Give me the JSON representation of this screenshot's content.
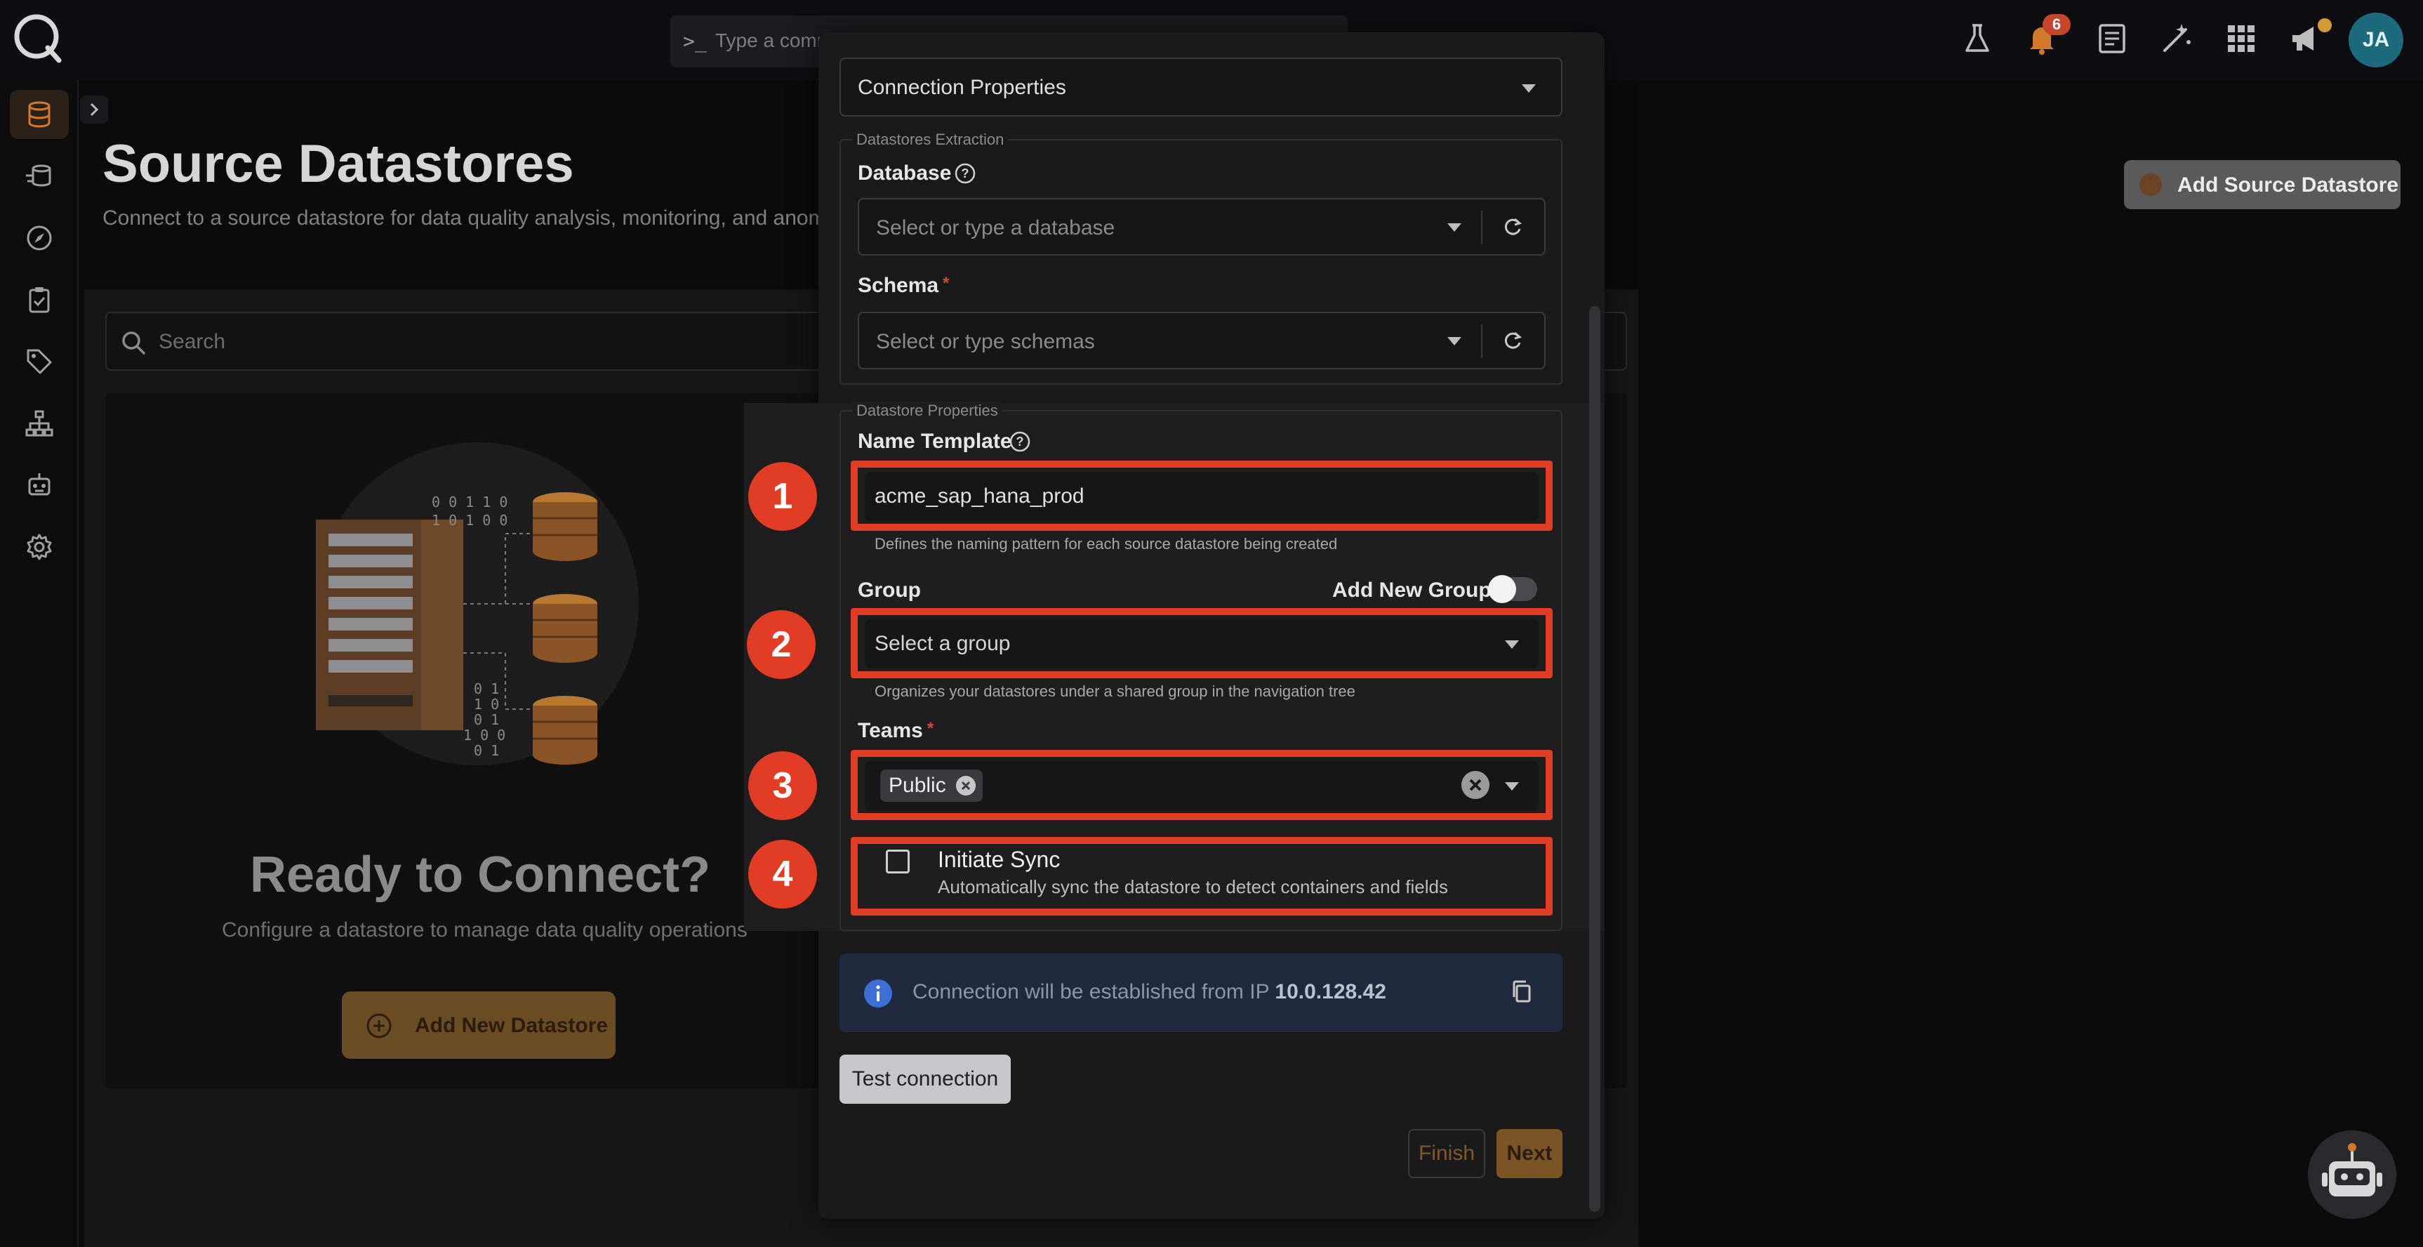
{
  "topbar": {
    "command_placeholder": "Type a comm",
    "command_prompt": ">_",
    "notification_count": "6",
    "avatar_initials": "JA"
  },
  "sidebar": {
    "items": [
      {
        "icon": "database-icon",
        "active": true
      },
      {
        "icon": "datastore-stack-icon"
      },
      {
        "icon": "compass-icon"
      },
      {
        "icon": "clipboard-check-icon"
      },
      {
        "icon": "tag-icon"
      },
      {
        "icon": "hierarchy-icon"
      },
      {
        "icon": "robot-icon"
      },
      {
        "icon": "gear-icon"
      }
    ]
  },
  "page": {
    "title": "Source Datastores",
    "subtitle": "Connect to a source datastore for data quality analysis, monitoring, and anomal",
    "add_source_label": "Add Source Datastore",
    "search_placeholder": "Search",
    "empty_title": "Ready to Connect?",
    "empty_subtitle": "Configure a datastore to manage data quality operations",
    "add_new_label": "Add New Datastore"
  },
  "illustration": {
    "binary_rows": [
      "0 0 1 1 0",
      "1 0 1 0 0"
    ],
    "binary_col": [
      "0 1",
      "1 0",
      "0 1",
      "1 0 0",
      "0 1"
    ]
  },
  "modal": {
    "connection_properties": "Connection Properties",
    "extraction": {
      "legend": "Datastores Extraction",
      "database_label": "Database",
      "database_placeholder": "Select or type a database",
      "schema_label": "Schema",
      "schema_placeholder": "Select or type schemas",
      "required_mark": "*"
    },
    "properties": {
      "legend": "Datastore Properties",
      "name_template_label": "Name Template",
      "name_template_value": "acme_sap_hana_prod",
      "name_template_hint": "Defines the naming pattern for each source datastore being created",
      "group_label": "Group",
      "add_new_group_label": "Add New Group",
      "add_new_group_enabled": false,
      "group_placeholder": "Select a group",
      "group_hint": "Organizes your datastores under a shared group in the navigation tree",
      "teams_label": "Teams",
      "teams_selected": [
        "Public"
      ],
      "initiate_sync_label": "Initiate Sync",
      "initiate_sync_desc": "Automatically sync the datastore to detect containers and fields",
      "initiate_sync_checked": false
    },
    "markers": [
      "1",
      "2",
      "3",
      "4"
    ],
    "info": {
      "text": "Connection will be established from IP",
      "ip": "10.0.128.42"
    },
    "test_connection_label": "Test connection",
    "finish_label": "Finish",
    "next_label": "Next"
  },
  "colors": {
    "accent": "#d79a33",
    "highlight": "#e23d24",
    "modal_bg": "#1a1a1b",
    "info_bg": "#1f2a3e"
  }
}
